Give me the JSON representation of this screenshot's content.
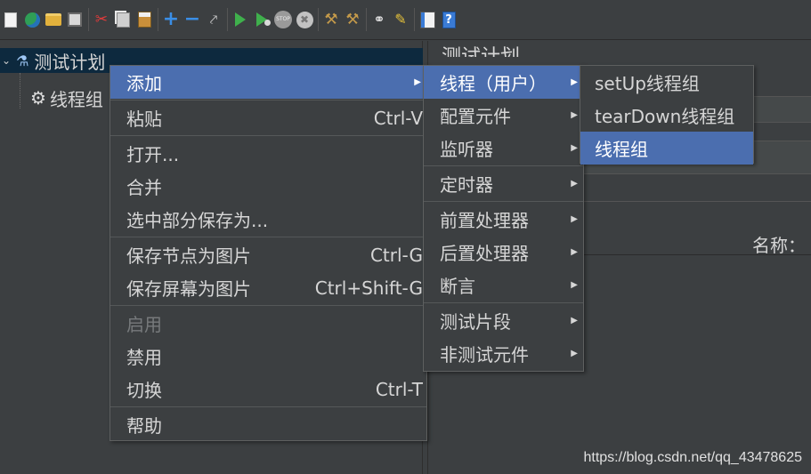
{
  "toolbar": {
    "icons": [
      "new-icon",
      "templates-icon",
      "open-icon",
      "save-icon",
      "cut-icon",
      "copy-icon",
      "paste-icon",
      "expand-icon",
      "collapse-icon",
      "toggle-icon",
      "start-icon",
      "start-no-timers-icon",
      "stop-icon",
      "shutdown-icon",
      "clear-icon",
      "clear-all-icon",
      "search-icon",
      "reset-search-icon",
      "function-helper-icon",
      "help-icon"
    ],
    "stop_text": "STOP"
  },
  "tree": {
    "root_label": "测试计划",
    "child_label": "线程组"
  },
  "right_panel": {
    "title": "测试计划",
    "name_label": "名称："
  },
  "context_menu": {
    "items": [
      {
        "label": "添加",
        "accel": "",
        "submenu": true,
        "selected": true,
        "disabled": false
      },
      {
        "label": "粘贴",
        "accel": "Ctrl-V",
        "submenu": false,
        "selected": false,
        "disabled": false
      },
      {
        "label": "打开...",
        "accel": "",
        "submenu": false,
        "selected": false,
        "disabled": false
      },
      {
        "label": "合并",
        "accel": "",
        "submenu": false,
        "selected": false,
        "disabled": false
      },
      {
        "label": "选中部分保存为...",
        "accel": "",
        "submenu": false,
        "selected": false,
        "disabled": false
      },
      {
        "label": "保存节点为图片",
        "accel": "Ctrl-G",
        "submenu": false,
        "selected": false,
        "disabled": false
      },
      {
        "label": "保存屏幕为图片",
        "accel": "Ctrl+Shift-G",
        "submenu": false,
        "selected": false,
        "disabled": false
      },
      {
        "label": "启用",
        "accel": "",
        "submenu": false,
        "selected": false,
        "disabled": true
      },
      {
        "label": "禁用",
        "accel": "",
        "submenu": false,
        "selected": false,
        "disabled": false
      },
      {
        "label": "切换",
        "accel": "Ctrl-T",
        "submenu": false,
        "selected": false,
        "disabled": false
      },
      {
        "label": "帮助",
        "accel": "",
        "submenu": false,
        "selected": false,
        "disabled": false
      }
    ]
  },
  "add_menu": {
    "items": [
      {
        "label": "线程（用户）",
        "selected": true
      },
      {
        "label": "配置元件",
        "selected": false
      },
      {
        "label": "监听器",
        "selected": false
      },
      {
        "label": "定时器",
        "selected": false
      },
      {
        "label": "前置处理器",
        "selected": false
      },
      {
        "label": "后置处理器",
        "selected": false
      },
      {
        "label": "断言",
        "selected": false
      },
      {
        "label": "测试片段",
        "selected": false
      },
      {
        "label": "非测试元件",
        "selected": false
      }
    ]
  },
  "thread_menu": {
    "items": [
      {
        "label": "setUp线程组",
        "selected": false
      },
      {
        "label": "tearDown线程组",
        "selected": false
      },
      {
        "label": "线程组",
        "selected": true
      }
    ]
  },
  "watermark": "https://blog.csdn.net/qq_43478625",
  "colors": {
    "background": "#3c3f41",
    "selection": "#4b6eaf",
    "tree_selection": "#0d293e"
  }
}
